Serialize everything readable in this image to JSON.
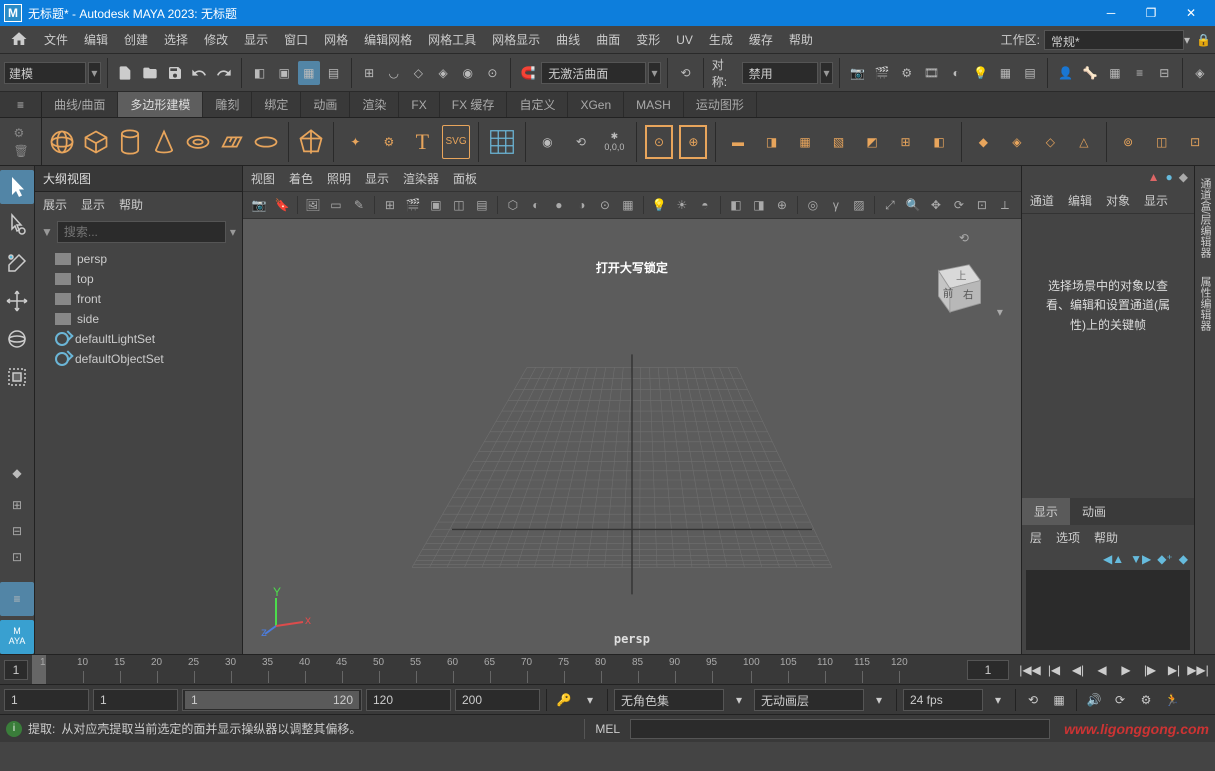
{
  "titlebar": {
    "logo": "M",
    "title": "无标题* - Autodesk MAYA 2023: 无标题"
  },
  "menubar": {
    "items": [
      "文件",
      "编辑",
      "创建",
      "选择",
      "修改",
      "显示",
      "窗口",
      "网格",
      "编辑网格",
      "网格工具",
      "网格显示",
      "曲线",
      "曲面",
      "变形",
      "UV",
      "生成",
      "缓存",
      "帮助"
    ],
    "workspace_label": "工作区:",
    "workspace_value": "常规*"
  },
  "toolbar": {
    "mode": "建模",
    "no_active_surface": "无激活曲面",
    "symmetry_label": "对称:",
    "symmetry_value": "禁用"
  },
  "shelf": {
    "tabs": [
      "曲线/曲面",
      "多边形建模",
      "雕刻",
      "绑定",
      "动画",
      "渲染",
      "FX",
      "FX 缓存",
      "自定义",
      "XGen",
      "MASH",
      "运动图形"
    ],
    "active_tab_index": 1
  },
  "outliner": {
    "title": "大纲视图",
    "menu": [
      "展示",
      "显示",
      "帮助"
    ],
    "search_placeholder": "搜索...",
    "items": [
      {
        "type": "camera",
        "name": "persp"
      },
      {
        "type": "camera",
        "name": "top"
      },
      {
        "type": "camera",
        "name": "front"
      },
      {
        "type": "camera",
        "name": "side"
      },
      {
        "type": "set",
        "name": "defaultLightSet"
      },
      {
        "type": "set",
        "name": "defaultObjectSet"
      }
    ]
  },
  "viewport": {
    "menu": [
      "视图",
      "着色",
      "照明",
      "显示",
      "渲染器",
      "面板"
    ],
    "caps_hint": "打开大写锁定",
    "camera_label": "persp",
    "cube_faces": {
      "front": "前",
      "right": "右",
      "top": "上"
    }
  },
  "right_panel": {
    "tabs": [
      "通道",
      "编辑",
      "对象",
      "显示"
    ],
    "hint": "选择场景中的对象以查看、编辑和设置通道(属性)上的关键帧",
    "lower_tabs": [
      "显示",
      "动画"
    ],
    "layer_menu": [
      "层",
      "选项",
      "帮助"
    ]
  },
  "right_sidebar": {
    "tabs": [
      "通道盒/层编辑器",
      "属性编辑器"
    ]
  },
  "timeline": {
    "start_frame": "1",
    "end_frame": "200",
    "ticks": [
      "1",
      "10",
      "15",
      "20",
      "25",
      "30",
      "35",
      "40",
      "45",
      "50",
      "55",
      "60",
      "65",
      "70",
      "75",
      "80",
      "85",
      "90",
      "95",
      "100",
      "105",
      "110",
      "115",
      "120"
    ]
  },
  "range": {
    "anim_start": "1",
    "play_start": "1",
    "slider_start": "1",
    "slider_end": "120",
    "play_end": "120",
    "anim_end": "200",
    "char_set": "无角色集",
    "anim_layer": "无动画层",
    "fps": "24 fps"
  },
  "status": {
    "hint_label": "提取:",
    "hint_text": "从对应壳提取当前选定的面并显示操纵器以调整其偏移。",
    "mel_label": "MEL",
    "watermark": "www.ligonggong.com"
  }
}
